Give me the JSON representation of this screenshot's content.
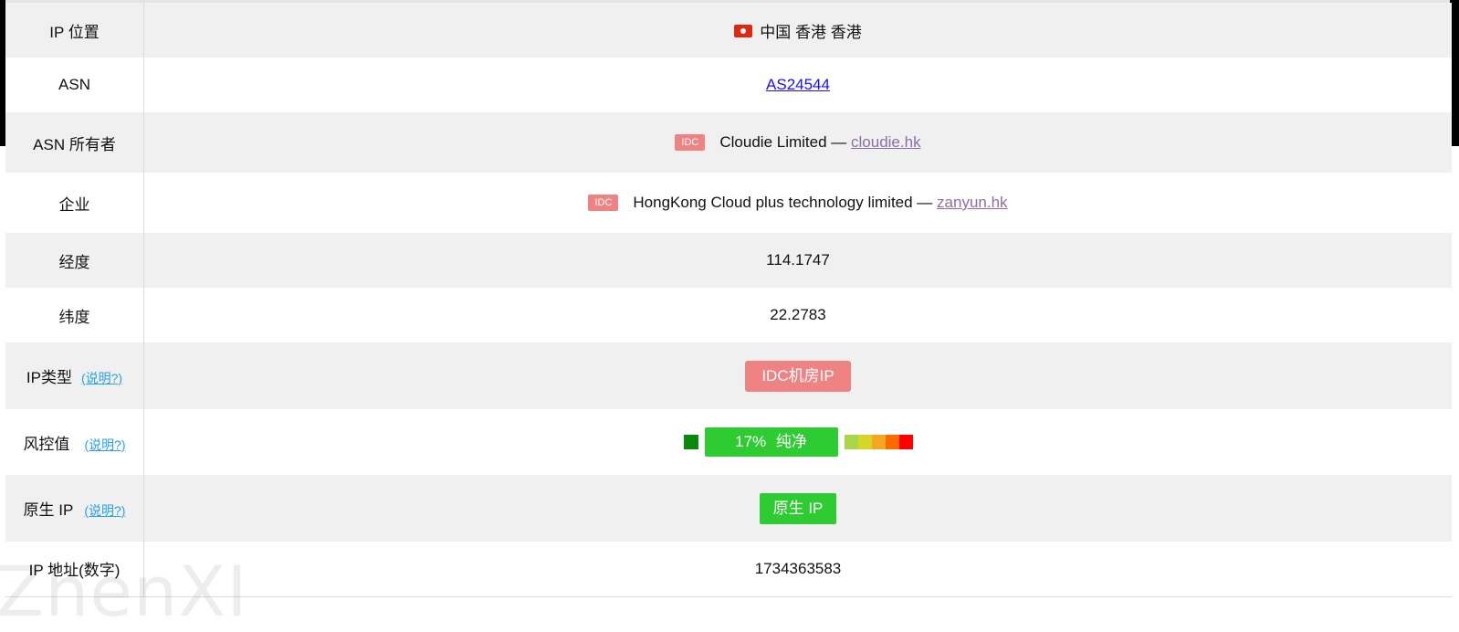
{
  "rows": {
    "location": {
      "label": "IP 位置",
      "value": "中国 香港 香港",
      "flag_icon": "hong-kong-flag-icon"
    },
    "asn": {
      "label": "ASN",
      "value": "AS24544"
    },
    "asn_owner": {
      "label": "ASN 所有者",
      "badge": "IDC",
      "name": "Cloudie Limited —",
      "domain": "cloudie.hk"
    },
    "enterprise": {
      "label": "企业",
      "badge": "IDC",
      "name": "HongKong Cloud plus technology limited —",
      "domain": "zanyun.hk"
    },
    "longitude": {
      "label": "经度",
      "value": "114.1747"
    },
    "latitude": {
      "label": "纬度",
      "value": "22.2783"
    },
    "ip_type": {
      "label": "IP类型",
      "help": "(说明?)",
      "value": "IDC机房IP"
    },
    "risk": {
      "label": "风控值",
      "help": "(说明?)",
      "value": "17%  纯净",
      "percent": 17,
      "scale_colors": [
        "#a8d84a",
        "#d6d62a",
        "#f5a623",
        "#ff6a00",
        "#ff0000"
      ]
    },
    "native_ip": {
      "label": "原生 IP",
      "help": "(说明?)",
      "value": "原生 IP"
    },
    "ip_numeric": {
      "label": "IP 地址(数字)",
      "value": "1734363583"
    }
  },
  "colors": {
    "idc_badge": "#ef8282",
    "clean_green": "#2ecc32",
    "link_blue": "#1a0dff",
    "help_blue": "#2aa0e6"
  },
  "watermark": "ZhenXI"
}
